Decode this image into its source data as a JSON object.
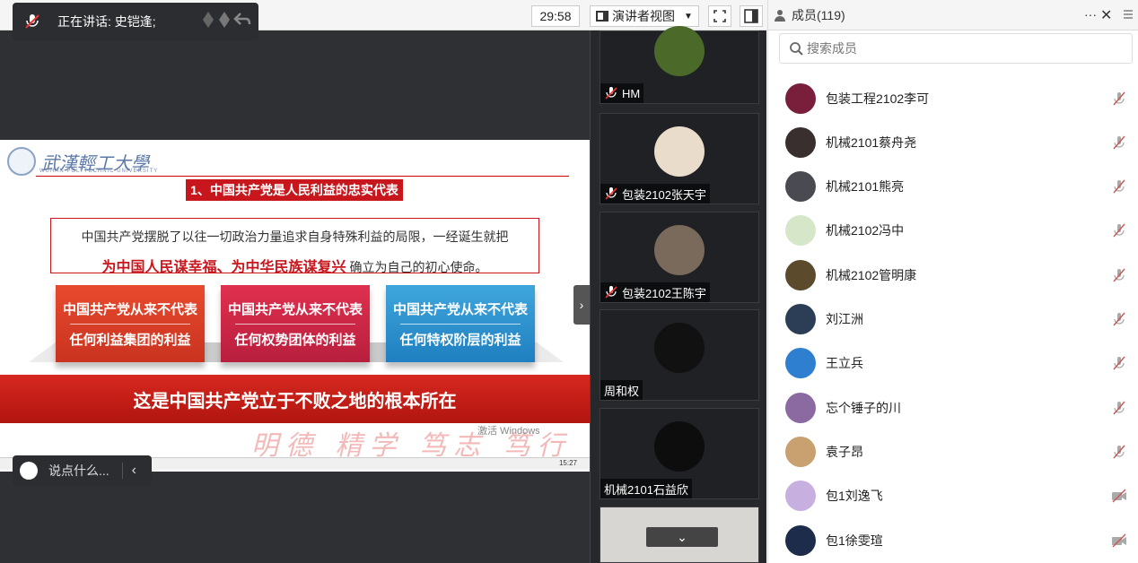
{
  "topbar": {
    "speaking_label": "正在讲话: 史铠逢;",
    "timer": "29:58",
    "view_mode": "演讲者视图"
  },
  "slide": {
    "logo_text": "武漢輕工大學",
    "logo_sub": "WUHAN POLYTECHNIC UNIVERSITY",
    "title": "1、中国共产党是人民利益的忠实代表",
    "quote_line1": "中国共产党摆脱了以往一切政治力量追求自身特殊利益的局限，一经诞生就把",
    "quote_emph": "为中国人民谋幸福、为中华民族谋复兴",
    "quote_tail": "确立为自己的初心使命。",
    "cards": [
      {
        "top": "中国共产党从来不代表",
        "bottom": "任何利益集团的利益"
      },
      {
        "top": "中国共产党从来不代表",
        "bottom": "任何权势团体的利益"
      },
      {
        "top": "中国共产党从来不代表",
        "bottom": "任何特权阶层的利益"
      }
    ],
    "banner": "这是中国共产党立于不败之地的根本所在",
    "calligraphy": "明德 精学 笃志 笃行",
    "activate": "激活 Windows",
    "clock": "15:27"
  },
  "chat": {
    "placeholder": "说点什么..."
  },
  "tiles": [
    {
      "name": "HM",
      "muted": true,
      "color": "#4b6a2a"
    },
    {
      "name": "包装2102张天宇",
      "muted": true,
      "color": "#e9dccb"
    },
    {
      "name": "包装2102王陈宇",
      "muted": true,
      "color": "#7a6a5c"
    },
    {
      "name": "周和权",
      "muted": false,
      "color": "#111111"
    },
    {
      "name": "机械2101石益欣",
      "muted": false,
      "color": "#0d0d0d"
    }
  ],
  "members": {
    "title": "成员(119)",
    "search_placeholder": "搜索成员",
    "list": [
      {
        "name": "包装工程2102李可",
        "status": "mic-muted",
        "color": "#7a1f3b"
      },
      {
        "name": "机械2101蔡舟尧",
        "status": "mic-muted",
        "color": "#3a2f2f"
      },
      {
        "name": "机械2101熊亮",
        "status": "mic-muted",
        "color": "#4a4a52"
      },
      {
        "name": "机械2102冯中",
        "status": "mic-muted",
        "color": "#d6e6c9"
      },
      {
        "name": "机械2102管明康",
        "status": "mic-muted",
        "color": "#5b4a2c"
      },
      {
        "name": "刘江洲",
        "status": "mic-muted",
        "color": "#2b3e55"
      },
      {
        "name": "王立兵",
        "status": "mic-muted",
        "color": "#2f7fd0"
      },
      {
        "name": "忘个锤子的川",
        "status": "mic-muted",
        "color": "#8a6aa0"
      },
      {
        "name": "袁子昂",
        "status": "mic-muted",
        "color": "#c9a070"
      },
      {
        "name": "包1刘逸飞",
        "status": "video-off",
        "color": "#c7b0e0"
      },
      {
        "name": "包1徐雯瑄",
        "status": "video-off",
        "color": "#1c2c4a"
      }
    ]
  }
}
